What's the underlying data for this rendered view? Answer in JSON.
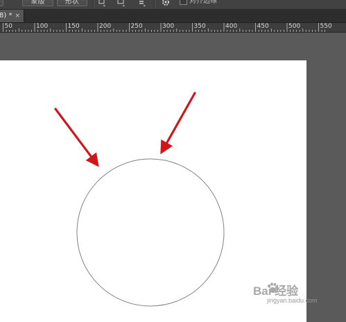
{
  "options_bar": {
    "button_1_label": "",
    "button_2_label": "蒙版",
    "button_3_label": "形状",
    "checkbox_label": "对齐边缘",
    "icons": [
      "path-operations-icon",
      "path-alignment-icon",
      "path-arrangement-icon",
      "gear-icon"
    ]
  },
  "document_tab": {
    "title": "8) *",
    "close_glyph": "×"
  },
  "ruler": {
    "labels": [
      "50",
      "100",
      "150",
      "200",
      "250",
      "300",
      "350",
      "400",
      "450",
      "500",
      "550"
    ],
    "units_per_label": 50
  },
  "canvas": {
    "background": "#ffffff",
    "shape": "ellipse",
    "stroke_color": "#777777",
    "arrow_color": "#d0161a"
  },
  "watermark": {
    "brand": "Bai  经验",
    "url": "jingyan.baidu.com"
  },
  "colors": {
    "workspace": "#5a5a5a",
    "chrome": "#424242",
    "tab_active": "#555555"
  }
}
